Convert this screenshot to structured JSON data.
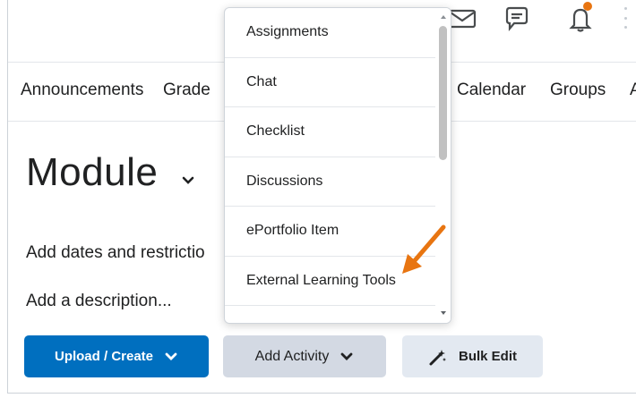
{
  "nav": {
    "items": [
      "Announcements",
      "Grade",
      "Calendar",
      "Groups",
      "A"
    ]
  },
  "module": {
    "title": "Module",
    "dates_text": "Add dates and restrictio",
    "description_text": "Add a description..."
  },
  "buttons": {
    "upload_label": "Upload / Create",
    "add_activity_label": "Add Activity",
    "bulk_edit_label": "Bulk Edit"
  },
  "dropdown": {
    "items": [
      "Assignments",
      "Chat",
      "Checklist",
      "Discussions",
      "ePortfolio Item",
      "External Learning Tools"
    ]
  },
  "colors": {
    "primary": "#006fbf",
    "secondary": "#d3d9e3",
    "tertiary": "#e3e9f1",
    "notification": "#e87511",
    "annotation_arrow": "#e87511"
  },
  "icons": {
    "mail": "mail-icon",
    "chat": "chat-icon",
    "bell": "bell-icon",
    "more": "kebab-icon",
    "wand": "magic-wand-icon"
  }
}
